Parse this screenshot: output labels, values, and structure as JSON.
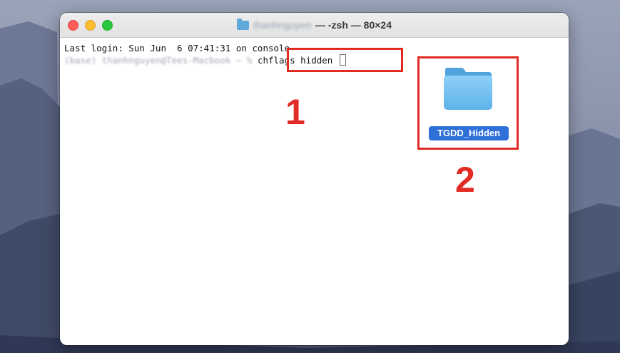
{
  "window": {
    "title_user": "thanhnguyen",
    "title_rest": "— -zsh — 80×24"
  },
  "terminal": {
    "line1": "Last login: Sun Jun  6 07:41:31 on console",
    "prompt": "(base) thanhnguyen@Tees-Macbook ~ % ",
    "command": "chflags hidden "
  },
  "desktop": {
    "folder_name": "TGDD_Hidden",
    "folder_icon": "folder-icon"
  },
  "annotations": {
    "step1": "1",
    "step2": "2",
    "color": "#e12b24"
  }
}
